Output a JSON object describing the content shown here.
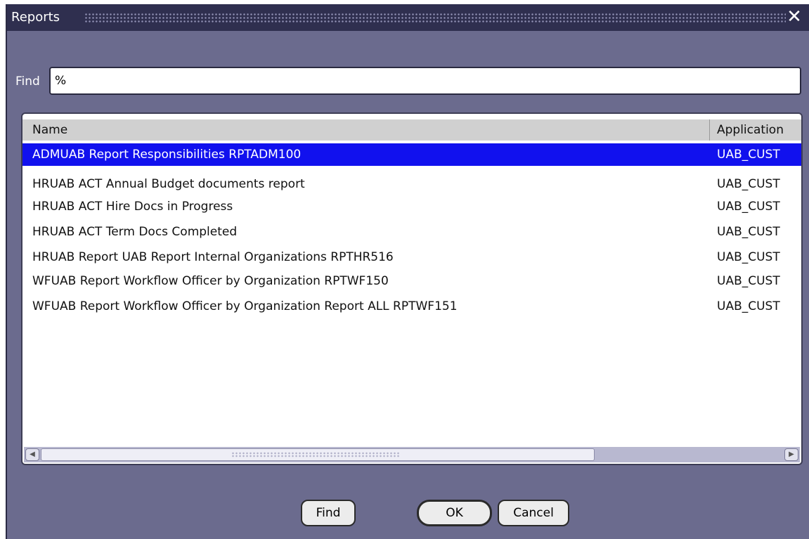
{
  "window": {
    "title": "Reports",
    "close_glyph": "✕"
  },
  "find": {
    "label": "Find",
    "value": "%"
  },
  "list": {
    "columns": {
      "name": "Name",
      "application": "Application"
    },
    "rows": [
      {
        "name": "ADMUAB Report Responsibilities RPTADM100",
        "application": "UAB_CUST"
      },
      {
        "name": "HRUAB ACT Annual Budget documents report",
        "application": "UAB_CUST"
      },
      {
        "name": "HRUAB ACT Hire Docs in Progress",
        "application": "UAB_CUST"
      },
      {
        "name": "HRUAB ACT Term Docs Completed",
        "application": "UAB_CUST"
      },
      {
        "name": "HRUAB Report UAB Report Internal Organizations RPTHR516",
        "application": "UAB_CUST"
      },
      {
        "name": "WFUAB Report Workflow Officer by Organization RPTWF150",
        "application": "UAB_CUST"
      },
      {
        "name": "WFUAB Report Workflow Officer by Organization Report ALL RPTWF151",
        "application": "UAB_CUST"
      }
    ],
    "selected_index": 0
  },
  "buttons": {
    "find": "Find",
    "ok": "OK",
    "cancel": "Cancel"
  },
  "colors": {
    "selection": "#1111ee",
    "window_bg": "#6b6b8e",
    "titlebar": "#2f2f4f"
  }
}
